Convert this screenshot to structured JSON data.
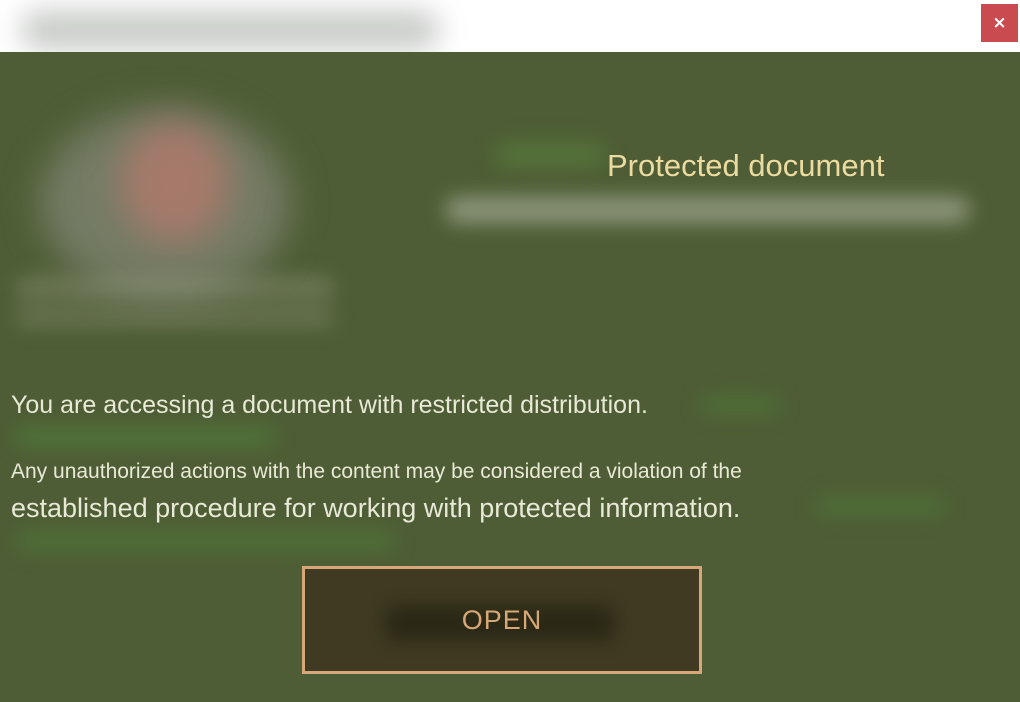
{
  "window": {
    "close_label": "×"
  },
  "overlay": {
    "heading": "Protected document",
    "message_line1": "You are accessing a document with restricted distribution.",
    "message_line2": "Any unauthorized actions with the content may be considered a violation of the",
    "message_line3": "established procedure for working with protected information.",
    "open_button_label": "OPEN"
  },
  "colors": {
    "overlay_background": "#4e5d35",
    "heading_text": "#ecdba0",
    "body_text": "#e8e9d6",
    "button_border": "#d6a877",
    "button_background": "#3f3a21",
    "close_button": "#c94a4f"
  },
  "icons": {
    "close": "close-icon"
  }
}
